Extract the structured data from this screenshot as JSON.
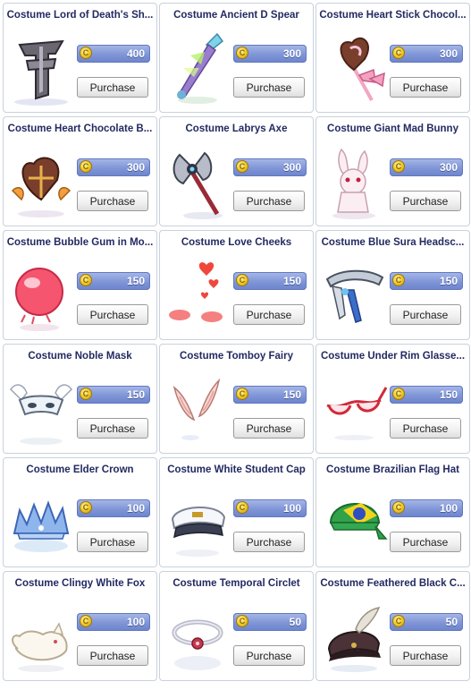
{
  "shop": {
    "currency_icon": "coin-icon",
    "coin_symbol": "C",
    "items": [
      {
        "name": "Costume Lord of Death's Sh...",
        "price": "400",
        "purchase_label": "Purchase",
        "icon": "dark-cross-shield-icon"
      },
      {
        "name": "Costume Ancient D Spear",
        "price": "300",
        "purchase_label": "Purchase",
        "icon": "crystal-spear-icon"
      },
      {
        "name": "Costume Heart Stick Chocol...",
        "price": "300",
        "purchase_label": "Purchase",
        "icon": "heart-lollipop-icon"
      },
      {
        "name": "Costume Heart Chocolate B...",
        "price": "300",
        "purchase_label": "Purchase",
        "icon": "heart-chocolate-box-icon"
      },
      {
        "name": "Costume Labrys Axe",
        "price": "300",
        "purchase_label": "Purchase",
        "icon": "double-axe-icon"
      },
      {
        "name": "Costume Giant Mad Bunny",
        "price": "300",
        "purchase_label": "Purchase",
        "icon": "bunny-plush-icon"
      },
      {
        "name": "Costume Bubble Gum in Mo...",
        "price": "150",
        "purchase_label": "Purchase",
        "icon": "pink-bubble-icon"
      },
      {
        "name": "Costume Love Cheeks",
        "price": "150",
        "purchase_label": "Purchase",
        "icon": "blush-hearts-icon"
      },
      {
        "name": "Costume Blue Sura Headsc...",
        "price": "150",
        "purchase_label": "Purchase",
        "icon": "blue-headscarf-icon"
      },
      {
        "name": "Costume Noble Mask",
        "price": "150",
        "purchase_label": "Purchase",
        "icon": "winged-mask-icon"
      },
      {
        "name": "Costume Tomboy Fairy",
        "price": "150",
        "purchase_label": "Purchase",
        "icon": "fairy-ears-icon"
      },
      {
        "name": "Costume Under Rim Glasse...",
        "price": "150",
        "purchase_label": "Purchase",
        "icon": "red-glasses-icon"
      },
      {
        "name": "Costume Elder Crown",
        "price": "100",
        "purchase_label": "Purchase",
        "icon": "ice-crown-icon"
      },
      {
        "name": "Costume White Student Cap",
        "price": "100",
        "purchase_label": "Purchase",
        "icon": "student-cap-icon"
      },
      {
        "name": "Costume Brazilian Flag Hat",
        "price": "100",
        "purchase_label": "Purchase",
        "icon": "flag-bandana-icon"
      },
      {
        "name": "Costume Clingy White Fox",
        "price": "100",
        "purchase_label": "Purchase",
        "icon": "white-fox-icon"
      },
      {
        "name": "Costume Temporal Circlet",
        "price": "50",
        "purchase_label": "Purchase",
        "icon": "circlet-icon"
      },
      {
        "name": "Costume Feathered Black C...",
        "price": "50",
        "purchase_label": "Purchase",
        "icon": "feathered-cap-icon"
      }
    ]
  }
}
